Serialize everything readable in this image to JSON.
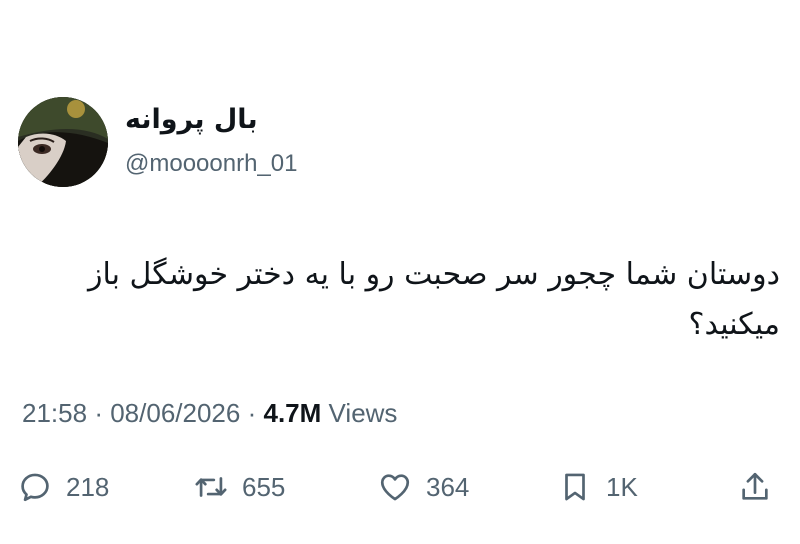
{
  "author": {
    "display_name": "بال پروانه",
    "handle": "@moooonrh_01"
  },
  "tweet": {
    "text": "دوستان شما چجور سر صحبت رو با یه دختر خوشگل باز میکنید؟"
  },
  "meta": {
    "time": "21:58",
    "separator": "·",
    "date": "08/06/2026",
    "views_count": "4.7M",
    "views_label": "Views"
  },
  "actions": {
    "replies": "218",
    "retweets": "655",
    "likes": "364",
    "bookmarks": "1K"
  },
  "colors": {
    "text": "#0f1419",
    "secondary": "#536471"
  }
}
